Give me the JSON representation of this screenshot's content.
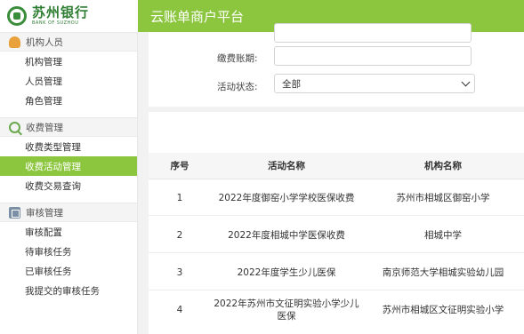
{
  "header": {
    "logo_cn": "苏州银行",
    "logo_en": "BANK OF SUZHOU",
    "platform_title": "云账单商户平台"
  },
  "sidebar": {
    "groups": [
      {
        "title": "机构人员",
        "icon": "person-icon",
        "items": [
          "机构管理",
          "人员管理",
          "角色管理"
        ]
      },
      {
        "title": "收费管理",
        "icon": "search-icon",
        "items": [
          "收费类型管理",
          "收费活动管理",
          "收费交易查询"
        ]
      },
      {
        "title": "审核管理",
        "icon": "grid-icon",
        "items": [
          "审核配置",
          "待审核任务",
          "已审核任务",
          "我提交的审核任务"
        ]
      }
    ],
    "active_item": "收费活动管理"
  },
  "filters": {
    "period_label": "缴费账期:",
    "period_value": "",
    "status_label": "活动状态:",
    "status_value": "全部"
  },
  "table": {
    "headers": [
      "序号",
      "活动名称",
      "机构名称"
    ],
    "rows": [
      {
        "no": "1",
        "activity": "2022年度御窑小学学校医保收费",
        "org": "苏州市相城区御窑小学"
      },
      {
        "no": "2",
        "activity": "2022年度相城中学医保收费",
        "org": "相城中学"
      },
      {
        "no": "3",
        "activity": "2022年度学生少儿医保",
        "org": "南京师范大学相城实验幼儿园"
      },
      {
        "no": "4",
        "activity": "2022年苏州市文征明实验小学少儿医保",
        "org": "苏州市相城区文征明实验小学"
      }
    ]
  }
}
